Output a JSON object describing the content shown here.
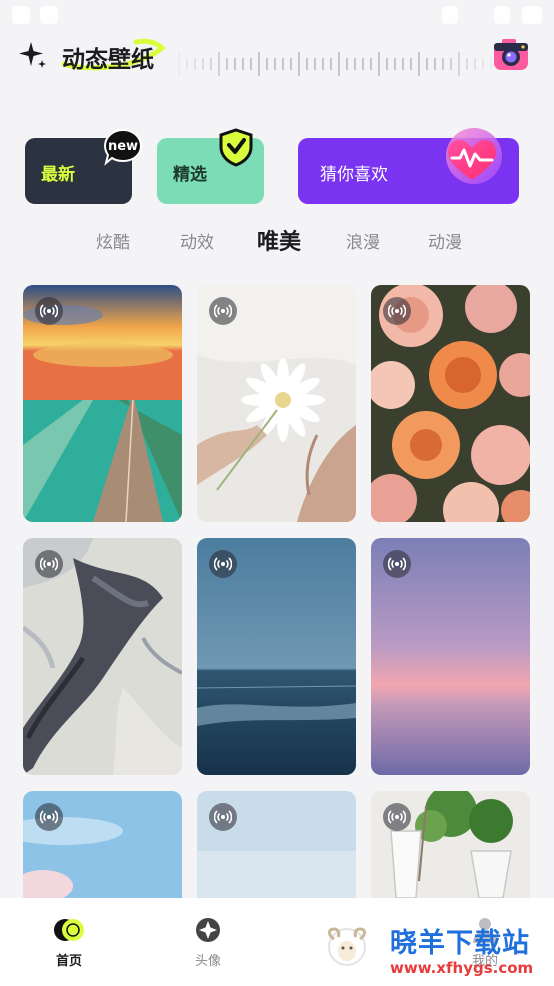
{
  "header": {
    "title": "动态壁纸",
    "sparkle_icon": "sparkle-icon",
    "camera_icon": "camera-icon"
  },
  "categories": [
    {
      "label": "最新",
      "badge": "new",
      "color": "#2b3240"
    },
    {
      "label": "精选",
      "badge_icon": "shield-check-icon",
      "color": "#7bdcb5"
    },
    {
      "label": "猜你喜欢",
      "badge_icon": "heart-icon",
      "color": "#7a33f0"
    }
  ],
  "tabs": [
    {
      "label": "炫酷",
      "active": false
    },
    {
      "label": "动效",
      "active": false
    },
    {
      "label": "唯美",
      "active": true
    },
    {
      "label": "浪漫",
      "active": false
    },
    {
      "label": "动漫",
      "active": false
    }
  ],
  "wallpapers": [
    {
      "subject": "sunset-road-sea",
      "badge_icon": "live-icon"
    },
    {
      "subject": "white-daisy-hands",
      "badge_icon": "live-icon"
    },
    {
      "subject": "orange-roses",
      "badge_icon": "live-icon"
    },
    {
      "subject": "abstract-paint-swirl",
      "badge_icon": "live-icon"
    },
    {
      "subject": "calm-ocean",
      "badge_icon": "live-icon"
    },
    {
      "subject": "purple-sunset-sky",
      "badge_icon": "live-icon"
    },
    {
      "subject": "blue-sky-clouds",
      "badge_icon": "live-icon"
    },
    {
      "subject": "pale-sky",
      "badge_icon": "live-icon"
    },
    {
      "subject": "glass-with-plant",
      "badge_icon": "live-icon"
    }
  ],
  "bottom_nav": [
    {
      "label": "首页",
      "icon": "home-icon",
      "active": true
    },
    {
      "label": "头像",
      "icon": "avatar-icon",
      "active": false
    },
    {
      "label": "我的",
      "icon": "profile-icon",
      "active": false
    }
  ],
  "watermark": {
    "name": "晓羊下载站",
    "url": "www.xfhygs.com"
  },
  "colors": {
    "accent_yellow": "#d9ff3c",
    "purple": "#7a33f0",
    "mint": "#7bdcb5"
  }
}
